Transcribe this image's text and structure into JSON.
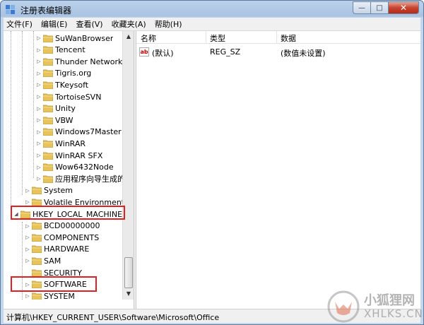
{
  "window": {
    "title": "注册表编辑器",
    "minimize_glyph": "—",
    "maximize_glyph": "□",
    "close_glyph": "✕"
  },
  "menu": [
    "文件(F)",
    "编辑(E)",
    "查看(V)",
    "收藏夹(A)",
    "帮助(H)"
  ],
  "tree": {
    "software_children": [
      "SuWanBrowser",
      "Tencent",
      "Thunder Network",
      "Tigris.org",
      "TKeysoft",
      "TortoiseSVN",
      "Unity",
      "VBW",
      "Windows7Master",
      "WinRAR",
      "WinRAR SFX",
      "Wow6432Node",
      "应用程序向导生成的本"
    ],
    "user_siblings": [
      "System",
      "Volatile Environment"
    ],
    "root_key": "HKEY_LOCAL_MACHINE",
    "hklm_children": [
      "BCD00000000",
      "COMPONENTS",
      "HARDWARE",
      "SAM",
      "SECURITY",
      "SOFTWARE",
      "SYSTEM"
    ],
    "expand_glyph": "▷",
    "expanded_glyph": "◢"
  },
  "list": {
    "columns": [
      "名称",
      "类型",
      "数据"
    ],
    "rows": [
      {
        "icon": "string-value-icon",
        "icon_text": "ab",
        "name": "(默认)",
        "type": "REG_SZ",
        "data": "(数值未设置)"
      }
    ]
  },
  "status": {
    "path": "计算机\\HKEY_CURRENT_USER\\Software\\Microsoft\\Office"
  },
  "watermark": {
    "cn": "小狐狸网",
    "en": "XHLKS.CN"
  },
  "colors": {
    "highlight": "#e02020",
    "folder": "#e8c35a",
    "title_bar": "#a9c3e2"
  }
}
